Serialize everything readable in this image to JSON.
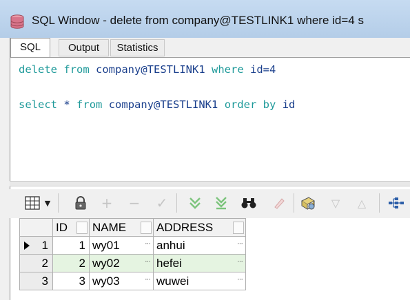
{
  "window": {
    "title": "SQL Window - delete from company@TESTLINK1 where id=4 s"
  },
  "tabs": [
    {
      "label": "SQL"
    },
    {
      "label": "Output"
    },
    {
      "label": "Statistics"
    }
  ],
  "editor": {
    "line1": {
      "kw1": "delete",
      "kw2": "from",
      "obj": "company@TESTLINK1",
      "kw3": "where",
      "cond": "id=4"
    },
    "line2": {
      "kw1": "select",
      "star": "*",
      "kw2": "from",
      "obj": "company@TESTLINK1",
      "kw3": "order by",
      "col": "id"
    }
  },
  "toolbar": {
    "icons": [
      "grid-select-icon",
      "dropdown-arrow-icon",
      "lock-icon",
      "add-record-icon",
      "delete-record-icon",
      "post-changes-icon",
      "fetch-next-icon",
      "fetch-last-icon",
      "find-icon",
      "clear-icon",
      "export-icon",
      "previous-icon",
      "next-icon",
      "query-tree-icon"
    ]
  },
  "results": {
    "columns": [
      "ID",
      "NAME",
      "ADDRESS"
    ],
    "rows": [
      {
        "num": "1",
        "id": "1",
        "name": "wy01",
        "address": "anhui"
      },
      {
        "num": "2",
        "id": "2",
        "name": "wy02",
        "address": "hefei"
      },
      {
        "num": "3",
        "id": "3",
        "name": "wy03",
        "address": "wuwei"
      }
    ],
    "ellipsis": "···"
  }
}
